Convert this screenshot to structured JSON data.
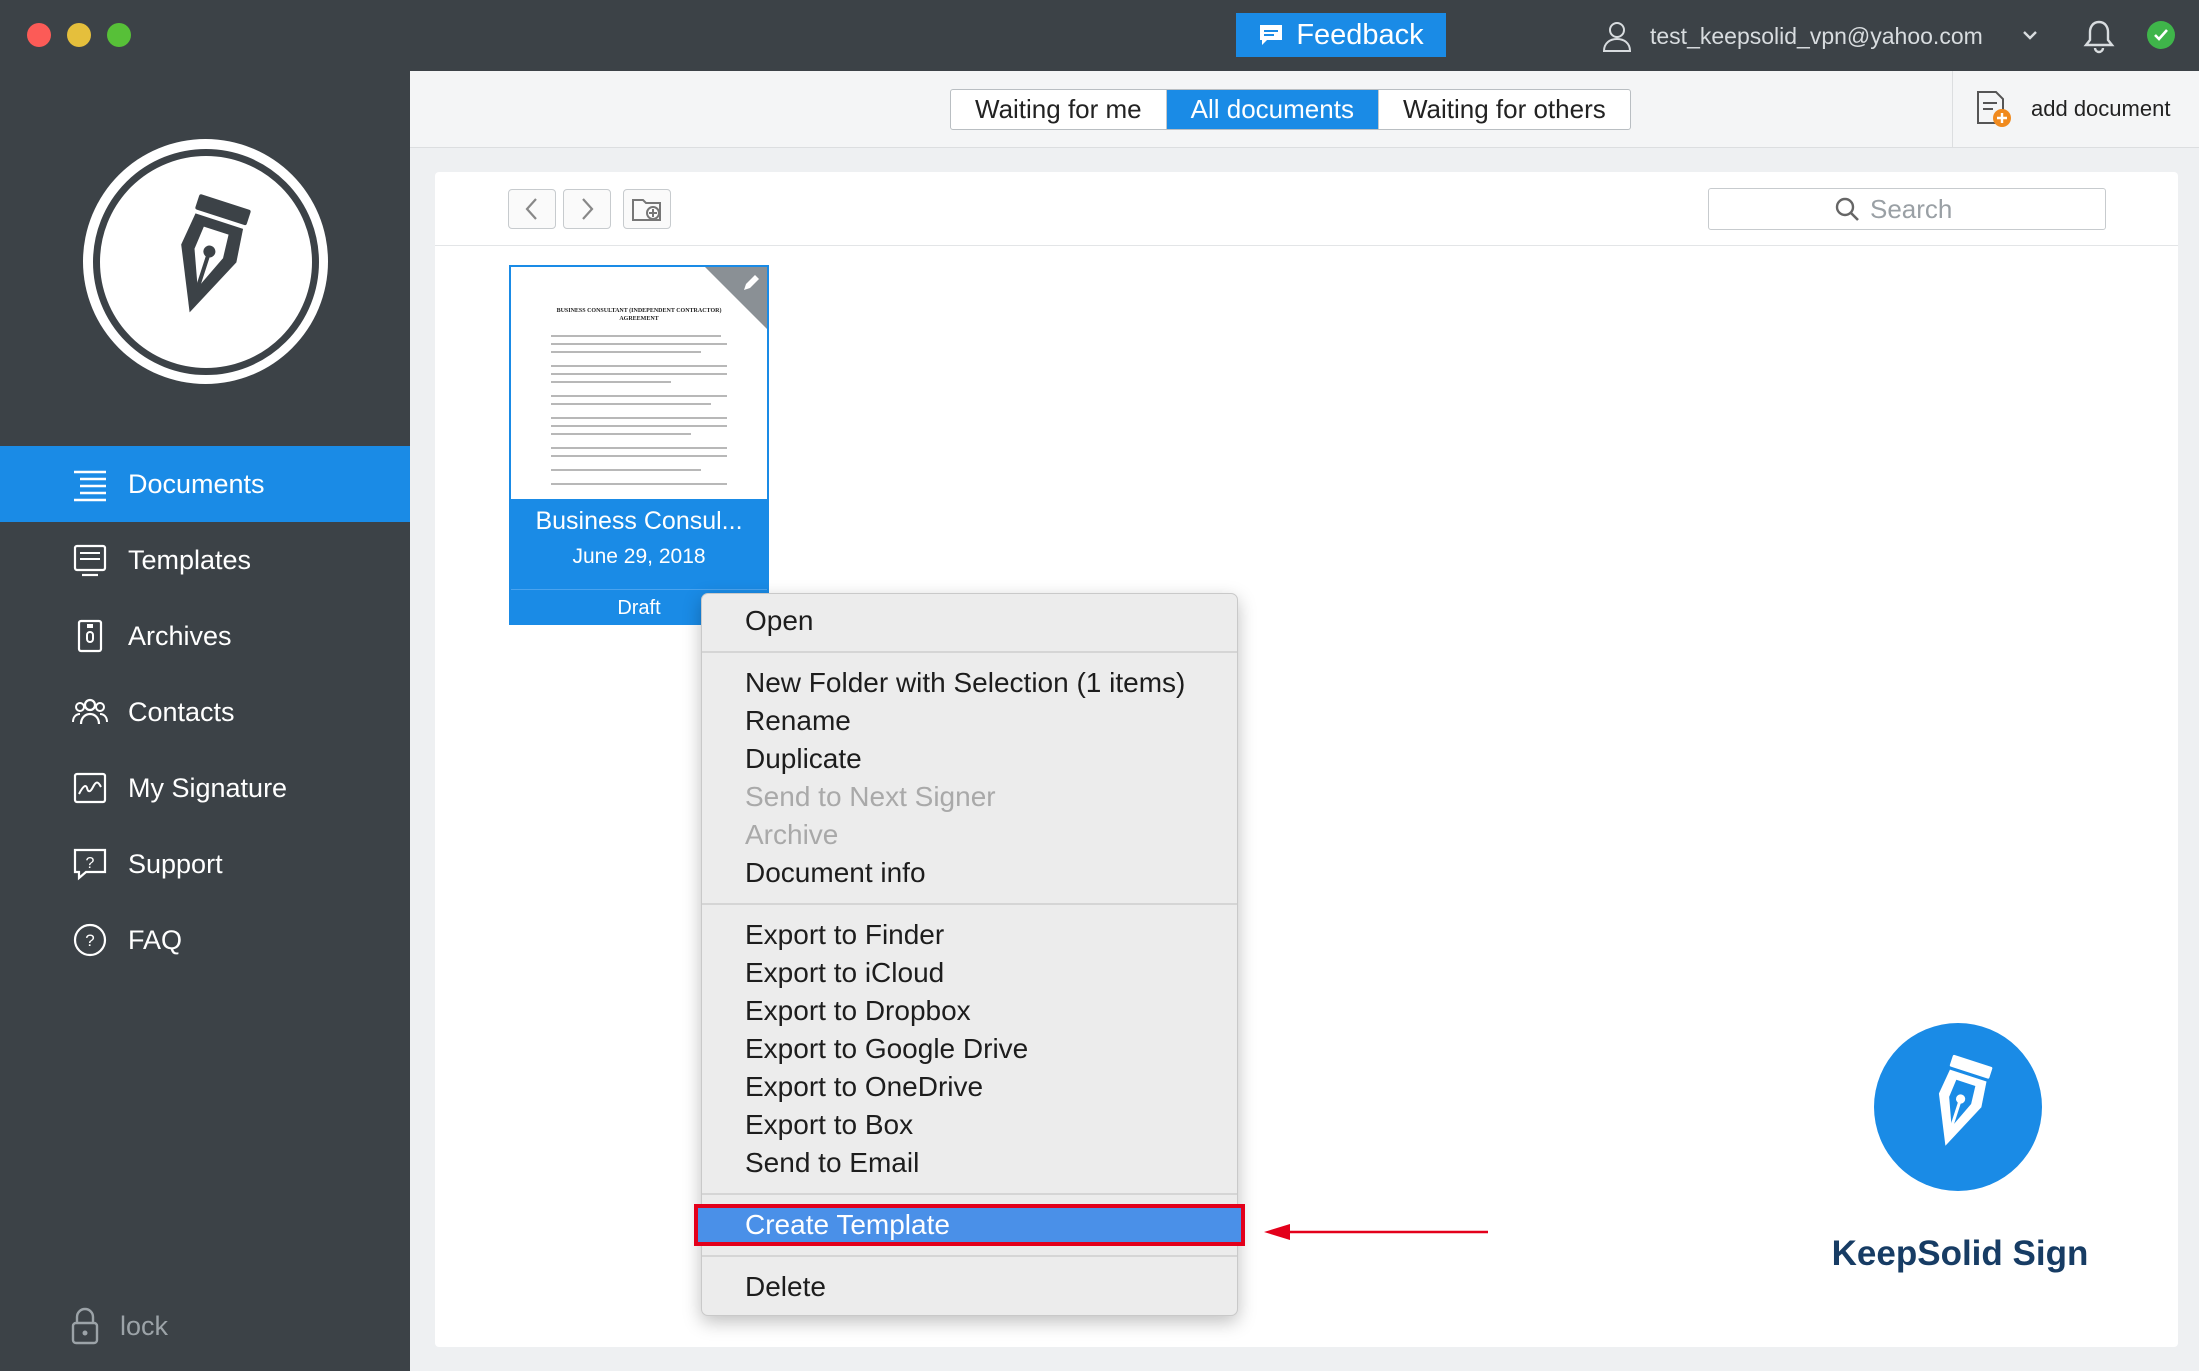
{
  "titlebar": {
    "feedback_label": "Feedback",
    "user_email": "test_keepsolid_vpn@yahoo.com"
  },
  "sidebar": {
    "items": [
      {
        "label": "Documents",
        "icon": "list-icon",
        "active": true
      },
      {
        "label": "Templates",
        "icon": "template-icon"
      },
      {
        "label": "Archives",
        "icon": "archive-icon"
      },
      {
        "label": "Contacts",
        "icon": "contacts-icon"
      },
      {
        "label": "My Signature",
        "icon": "signature-icon"
      },
      {
        "label": "Support",
        "icon": "support-icon"
      },
      {
        "label": "FAQ",
        "icon": "faq-icon"
      }
    ],
    "lock_label": "lock"
  },
  "tabs": [
    {
      "label": "Waiting for me"
    },
    {
      "label": "All documents",
      "active": true
    },
    {
      "label": "Waiting for others"
    }
  ],
  "add_document_label": "add document",
  "search": {
    "placeholder": "Search"
  },
  "document": {
    "name": "Business Consul...",
    "date": "June 29, 2018",
    "status": "Draft",
    "thumb_title": "BUSINESS CONSULTANT (INDEPENDENT CONTRACTOR) AGREEMENT"
  },
  "context_menu": {
    "groups": [
      [
        {
          "label": "Open"
        }
      ],
      [
        {
          "label": "New Folder with Selection (1 items)"
        },
        {
          "label": "Rename"
        },
        {
          "label": "Duplicate"
        },
        {
          "label": "Send to Next Signer",
          "disabled": true
        },
        {
          "label": "Archive",
          "disabled": true
        },
        {
          "label": "Document info"
        }
      ],
      [
        {
          "label": "Export to Finder"
        },
        {
          "label": "Export to iCloud"
        },
        {
          "label": "Export to Dropbox"
        },
        {
          "label": "Export to Google Drive"
        },
        {
          "label": "Export to OneDrive"
        },
        {
          "label": "Export to Box"
        },
        {
          "label": "Send to Email"
        }
      ],
      [
        {
          "label": "Create Template",
          "highlighted": true
        }
      ],
      [
        {
          "label": "Delete"
        }
      ]
    ]
  },
  "brand": {
    "name": "KeepSolid Sign"
  },
  "colors": {
    "accent": "#1a8be6",
    "sidebar": "#3c4247",
    "highlight_border": "#e3001b",
    "brand_text": "#173c64"
  }
}
